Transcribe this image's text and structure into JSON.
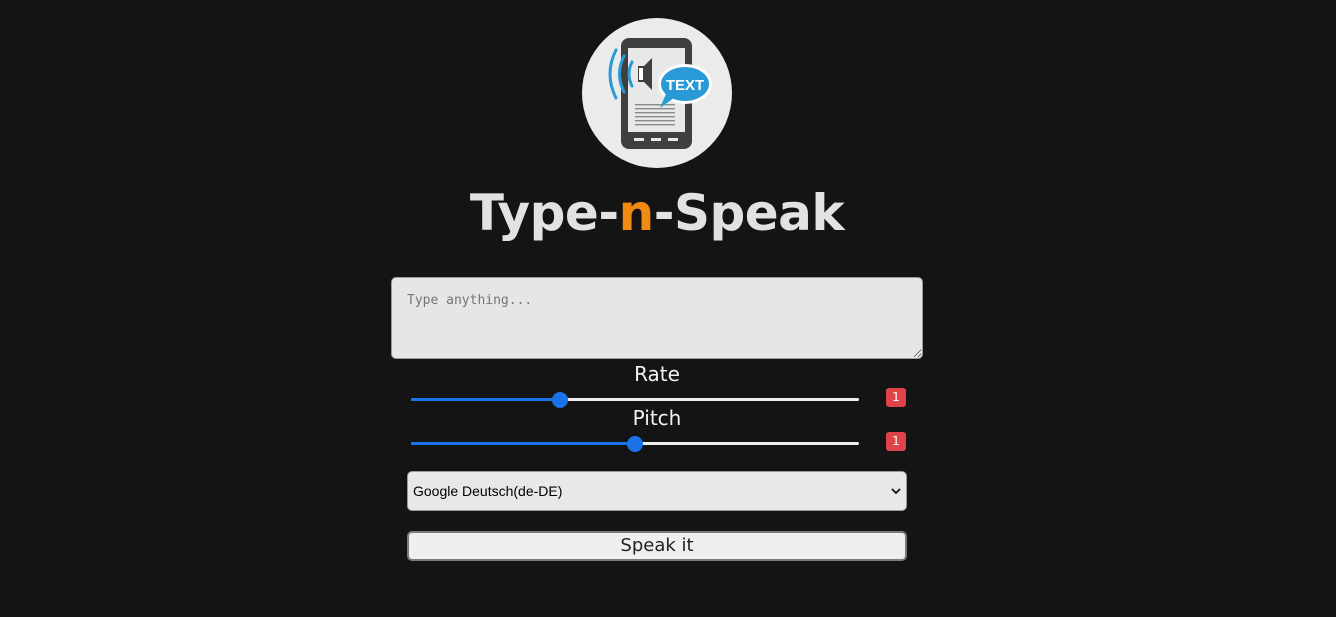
{
  "app": {
    "title_part1": "Type-",
    "title_accent": "n",
    "title_part2": "-Speak",
    "logo_text": "TEXT",
    "logo_icon": "phone-speaker-text-icon"
  },
  "input": {
    "placeholder": "Type anything..."
  },
  "rate": {
    "label": "Rate",
    "value_display": "1",
    "min": 0.5,
    "max": 2,
    "value": 1
  },
  "pitch": {
    "label": "Pitch",
    "value_display": "1",
    "min": 0,
    "max": 2,
    "value": 1
  },
  "voice": {
    "selected": "Google Deutsch(de-DE)"
  },
  "speak": {
    "label": "Speak it"
  },
  "colors": {
    "background": "#141414",
    "accent_orange": "#f08a10",
    "slider_blue": "#1a73e8",
    "badge_red": "#e0444a"
  }
}
